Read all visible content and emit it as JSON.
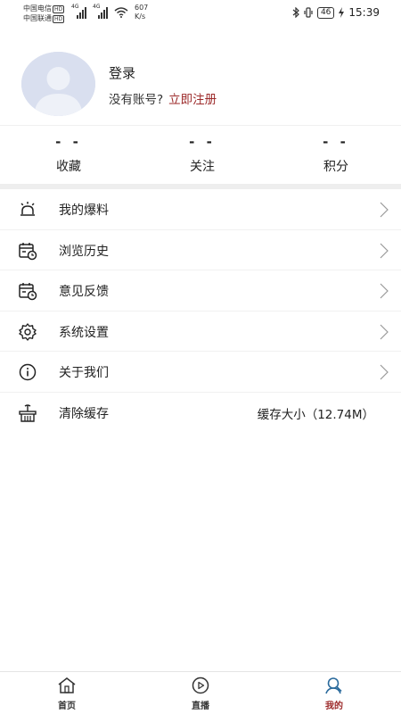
{
  "status_bar": {
    "carrier1": "中国电信",
    "carrier2": "中国联通",
    "hd": "HD",
    "net1": "4G",
    "net2": "4G",
    "speed_value": "607",
    "speed_unit": "K/s",
    "battery": "46",
    "time": "15:39"
  },
  "profile": {
    "login": "登录",
    "no_account": "没有账号?",
    "register": "立即注册"
  },
  "stats": [
    {
      "value": "- -",
      "label": "收藏"
    },
    {
      "value": "- -",
      "label": "关注"
    },
    {
      "value": "- -",
      "label": "积分"
    }
  ],
  "menu": [
    {
      "label": "我的爆料",
      "icon": "alarm-bell-icon"
    },
    {
      "label": "浏览历史",
      "icon": "calendar-clock-icon"
    },
    {
      "label": "意见反馈",
      "icon": "calendar-clock-icon"
    },
    {
      "label": "系统设置",
      "icon": "gear-icon"
    },
    {
      "label": "关于我们",
      "icon": "info-icon"
    },
    {
      "label": "清除缓存",
      "icon": "basket-icon",
      "value": "缓存大小（12.74M）"
    }
  ],
  "nav": [
    {
      "label": "首页",
      "icon": "home-icon"
    },
    {
      "label": "直播",
      "icon": "play-icon"
    },
    {
      "label": "我的",
      "icon": "user-search-icon",
      "active": true
    }
  ],
  "colors": {
    "accent": "#9c2a2a",
    "divider": "#eeeeee",
    "avatar_bg": "#d9dfef"
  }
}
